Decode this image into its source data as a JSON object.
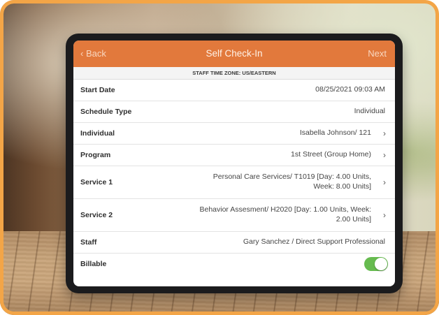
{
  "nav": {
    "back_label": "Back",
    "title": "Self Check-In",
    "next_label": "Next"
  },
  "timezone_label": "STAFF TIME ZONE: US/EASTERN",
  "rows": [
    {
      "label": "Start Date",
      "value": "08/25/2021 09:03 AM"
    },
    {
      "label": "Schedule Type",
      "value": "Individual"
    },
    {
      "label": "Individual",
      "value": "Isabella Johnson/ 121"
    },
    {
      "label": "Program",
      "value": "1st Street (Group Home)"
    },
    {
      "label": "Service 1",
      "value": "Personal Care Services/ T1019 [Day: 4.00 Units, Week: 8.00 Units]"
    },
    {
      "label": "Service 2",
      "value": "Behavior Assesment/ H2020 [Day: 1.00 Units, Week: 2.00 Units]"
    },
    {
      "label": "Staff",
      "value": "Gary Sanchez / Direct Support Professional"
    },
    {
      "label": "Billable",
      "on": true
    }
  ],
  "colors": {
    "accent": "#E2793C",
    "toggle_on": "#66BB4F",
    "border": "#F3A547"
  },
  "icons": {
    "back": "chevron-left-icon",
    "row_disclosure": "chevron-right-icon"
  }
}
